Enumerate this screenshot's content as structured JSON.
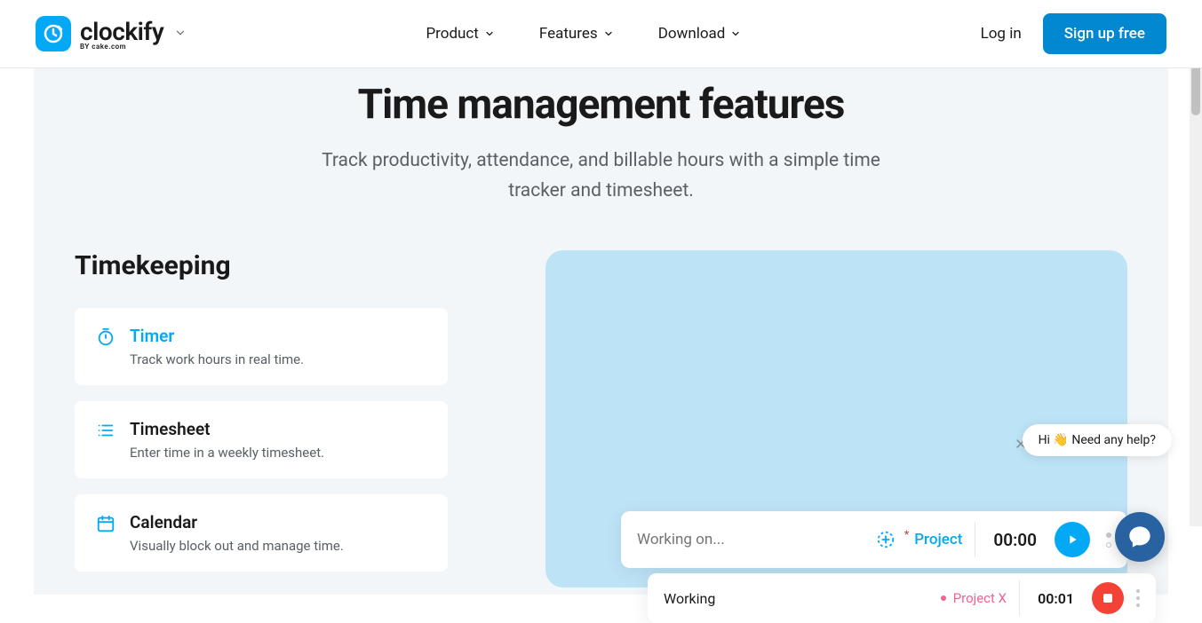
{
  "header": {
    "brand": "clockify",
    "brand_sub": "BY cake.com",
    "nav": [
      "Product",
      "Features",
      "Download"
    ],
    "login": "Log in",
    "signup": "Sign up free"
  },
  "hero": {
    "title": "Time management features",
    "subtitle_line1": "Track productivity, attendance, and billable hours with a simple time",
    "subtitle_line2": "tracker and timesheet."
  },
  "section_title": "Timekeeping",
  "features": [
    {
      "title": "Timer",
      "desc": "Track work hours in real time.",
      "active": true,
      "icon": "stopwatch"
    },
    {
      "title": "Timesheet",
      "desc": "Enter time in a weekly timesheet.",
      "active": false,
      "icon": "list"
    },
    {
      "title": "Calendar",
      "desc": "Visually block out and manage time.",
      "active": false,
      "icon": "calendar"
    }
  ],
  "timer": {
    "placeholder": "Working on...",
    "project_label": "Project",
    "time": "00:00"
  },
  "entry": {
    "text": "Working",
    "project": "Project X",
    "time": "00:01"
  },
  "chat": {
    "greeting": "Hi 👋 Need any help?"
  }
}
